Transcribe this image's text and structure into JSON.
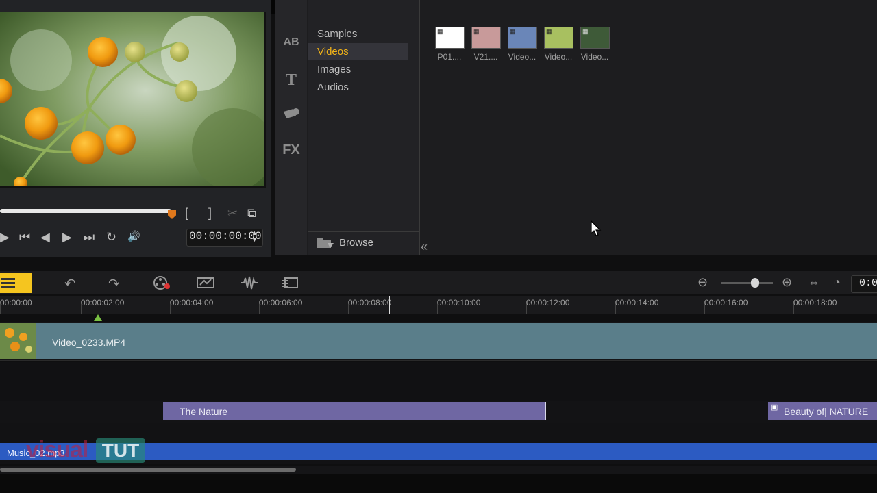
{
  "preview": {
    "timecode": "00:00:00:00",
    "controls": [
      "▶",
      "⏮",
      "◀",
      "▶",
      "⏭",
      "↻",
      "🔊"
    ],
    "mark_in": "[",
    "mark_out": "]",
    "cut_icon": "✂",
    "copy_icon": "⧉"
  },
  "library": {
    "icons": [
      "AB",
      "T",
      "FX"
    ],
    "nav_items": [
      {
        "label": "Samples"
      },
      {
        "label": "Videos"
      },
      {
        "label": "Images"
      },
      {
        "label": "Audios"
      }
    ],
    "browse_label": "Browse",
    "collapse_icon": "«",
    "thumbnails": [
      {
        "label": "P01....",
        "color": "#ffffff"
      },
      {
        "label": "V21....",
        "color": "#c89a9a"
      },
      {
        "label": "Video...",
        "color": "#6a86b8"
      },
      {
        "label": "Video...",
        "color": "#a8c060"
      },
      {
        "label": "Video...",
        "color": "#3e5a38"
      }
    ]
  },
  "timeline": {
    "ruler_ticks": [
      "00:00:00",
      "00:00:02:00",
      "00:00:04:00",
      "00:00:06:00",
      "00:00:08:00",
      "00:00:10:00",
      "00:00:12:00",
      "00:00:14:00",
      "00:00:16:00",
      "00:00:18:00"
    ],
    "right_timecode": "0:0",
    "video_clip": "Video_0233.MP4",
    "title_clip_1": "The Nature",
    "title_clip_2": "Beauty of| NATURE",
    "music_clip": "Music_02.mp3"
  },
  "watermark": {
    "text": "visual",
    "text2": "TUT"
  },
  "colors": {
    "accent": "#f5c51f",
    "video_clip": "#5a7e8a",
    "title_clip": "#6f67a3",
    "music_clip": "#2c5bc2"
  }
}
